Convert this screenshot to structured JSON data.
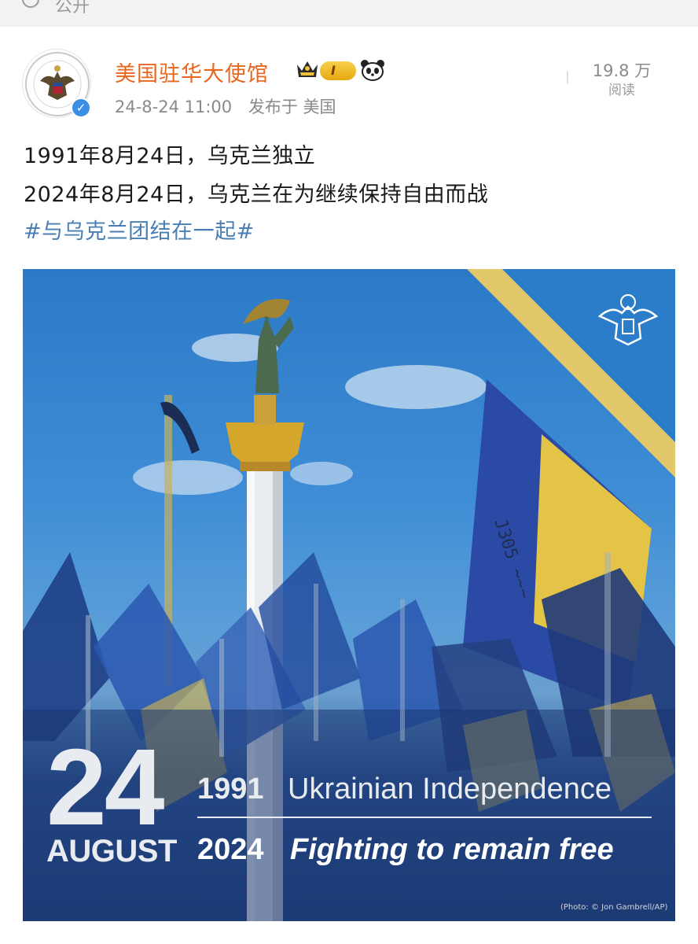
{
  "visibility_label": "公开",
  "post": {
    "author": "美国驻华大使馆",
    "level_badge": "I",
    "timestamp": "24-8-24 11:00",
    "location": "发布于 美国",
    "reads_count": "19.8 万",
    "reads_label": "阅读",
    "text_line_1": "1991年8月24日，乌克兰独立",
    "text_line_2": "2024年8月24日，乌克兰在为继续保持自由而战",
    "hashtag": "#与乌克兰团结在一起#"
  },
  "image": {
    "big_number": "24",
    "month": "AUGUST",
    "year_1991": "1991",
    "text_1991": "Ukrainian Independence",
    "year_2024": "2024",
    "text_2024": "Fighting to remain free",
    "credit": "(Photo: © Jon Gambrell/AP)"
  },
  "colors": {
    "author_name": "#e8661d",
    "hashtag": "#4a7fb6",
    "meta_gray": "#8a8a8a",
    "sky_blue": "#3f8dd6",
    "gold_stripe": "#e2c86a"
  },
  "icons": [
    "globe-icon",
    "crown-icon",
    "panda-icon",
    "verified-icon",
    "eagle-seal-icon"
  ]
}
